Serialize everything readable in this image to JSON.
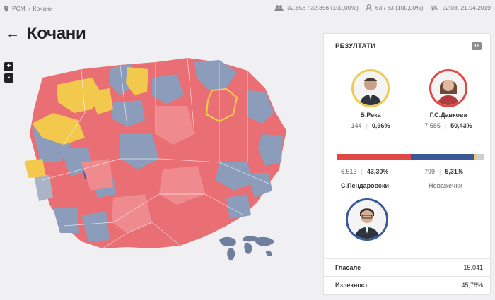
{
  "breadcrumb": {
    "root": "РСМ",
    "current": "Кочани"
  },
  "stats": {
    "voters": "32.856 / 32.856 (100,00%)",
    "stations": "63 / 63 (100,00%)",
    "updated": "22:08, 21.04.2019"
  },
  "page": {
    "title": "Кочани"
  },
  "zoom": {
    "in": "+",
    "out": "-"
  },
  "panel": {
    "title": "РЕЗУЛТАТИ",
    "badge": "16",
    "candidates": [
      {
        "name": "Б.Река",
        "votes": "144",
        "percent": "0,96%",
        "color": "#f2c94c"
      },
      {
        "name": "Г.С.Давкова",
        "votes": "7.585",
        "percent": "50,43%",
        "color": "#e04848"
      },
      {
        "name": "С.Пендаровски",
        "votes": "6.513",
        "percent": "43,30%",
        "color": "#3b5998"
      }
    ],
    "invalid": {
      "name": "Неважечки",
      "votes": "799",
      "percent": "5,31%"
    },
    "bar_share": [
      50.43,
      43.3,
      0.96,
      5.31
    ],
    "summary": {
      "votes_label": "Гласале",
      "votes_value": "15.041",
      "turnout_label": "Излезност",
      "turnout_value": "45,78%"
    }
  },
  "colors": {
    "red": "#ea6f74",
    "blue": "#8c9cbb",
    "yellow": "#f2c94c",
    "highlight": "#f4cf4a"
  }
}
